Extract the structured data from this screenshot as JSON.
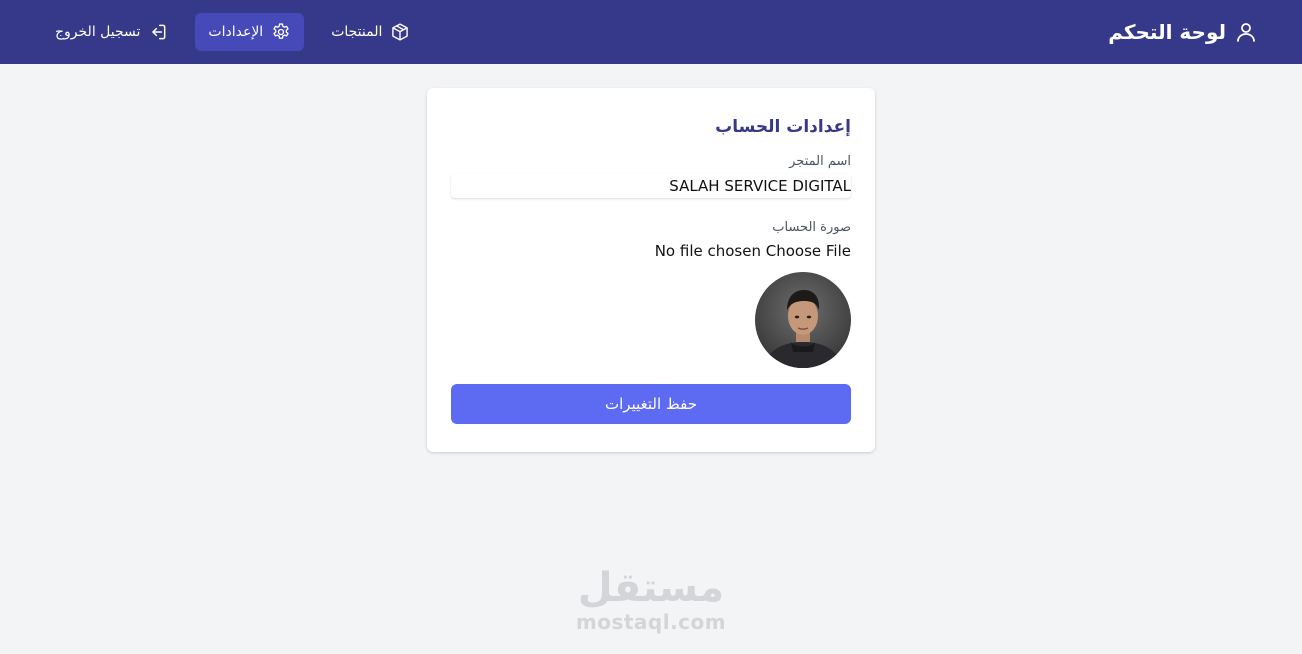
{
  "navbar": {
    "brand_title": "لوحة التحكم",
    "brand_icon": "user-icon",
    "links": [
      {
        "label": "المنتجات",
        "icon": "box-icon"
      },
      {
        "label": "الإعدادات",
        "icon": "gear-icon",
        "active": true
      },
      {
        "label": "تسجيل الخروج",
        "icon": "logout-icon"
      }
    ]
  },
  "settings": {
    "title": "إعدادات الحساب",
    "store_name_label": "اسم المتجر",
    "store_name_value": "SALAH SERVICE DIGITAL",
    "avatar_label": "صورة الحساب",
    "file_button": "Choose File",
    "file_status": "No file chosen",
    "save_label": "حفظ التغييرات"
  },
  "watermark": {
    "arabic": "مستقل",
    "latin": "mostaql.com"
  },
  "colors": {
    "navbar": "#36388a",
    "nav_active": "#4649b8",
    "primary_button": "#5d6bf3",
    "background": "#f3f4f6"
  }
}
